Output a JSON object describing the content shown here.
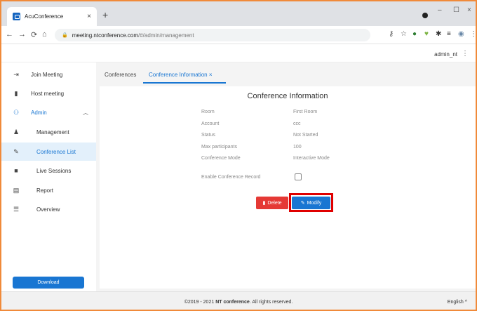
{
  "browser": {
    "tab_title": "AcuConference",
    "url_host": "meeting.ntconference.com",
    "url_path": "/#/admin/management",
    "icons": [
      "back-icon",
      "forward-icon",
      "reload-icon",
      "home-icon",
      "lock-icon",
      "key-icon",
      "star-icon",
      "extension-icon",
      "menu-icon"
    ]
  },
  "header": {
    "user": "admin_nt"
  },
  "sidebar": {
    "items": [
      {
        "label": "Join Meeting",
        "icon": "login-icon"
      },
      {
        "label": "Host meeting",
        "icon": "phone-icon"
      },
      {
        "label": "Admin",
        "icon": "admin-icon"
      },
      {
        "label": "Management",
        "icon": "users-icon"
      },
      {
        "label": "Conference List",
        "icon": "edit-icon"
      },
      {
        "label": "Live Sessions",
        "icon": "video-icon"
      },
      {
        "label": "Report",
        "icon": "report-icon"
      },
      {
        "label": "Overview",
        "icon": "list-icon"
      }
    ],
    "download_label": "Download"
  },
  "main": {
    "tabs": [
      {
        "label": "Conferences"
      },
      {
        "label": "Conference Information"
      }
    ],
    "card_title": "Conference Information",
    "fields": [
      {
        "label": "Room",
        "value": "First Room"
      },
      {
        "label": "Account",
        "value": "ccc"
      },
      {
        "label": "Status",
        "value": "Not Started"
      },
      {
        "label": "Max participants",
        "value": "100"
      },
      {
        "label": "Conference Mode",
        "value": "Interactive Mode"
      }
    ],
    "record_label": "Enable Conference Record",
    "delete_label": "Delete",
    "modify_label": "Modify"
  },
  "footer": {
    "copyright_prefix": "©2019 - 2021",
    "brand": "NT conference",
    "copyright_suffix": "All rights reserved.",
    "language": "English"
  },
  "colors": {
    "accent": "#1976d2",
    "danger": "#e53935",
    "highlight": "#e00000",
    "frame": "#f08a3a"
  }
}
